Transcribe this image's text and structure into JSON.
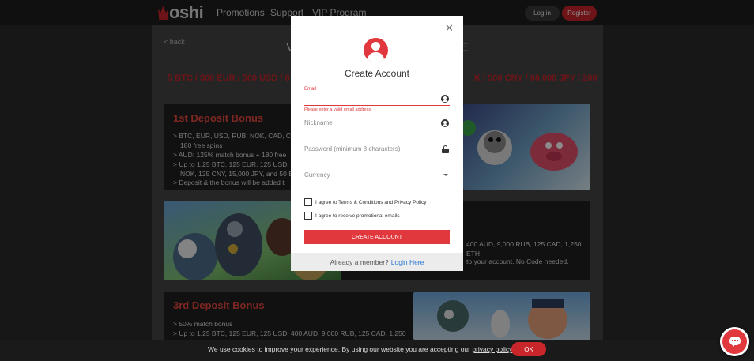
{
  "header": {
    "logo_text": "oshi",
    "nav": [
      "Promotions",
      "Support",
      "VIP Program"
    ],
    "login_label": "Log in",
    "register_label": "Register"
  },
  "page": {
    "back_label": "< back",
    "title_visible_start": "V",
    "title_visible_end": "E",
    "summary_left": "5 BTC / 500 EUR / 500 USD / 8",
    "summary_right": "K / 500 CNY / 60.000 JPY / 200"
  },
  "cards": [
    {
      "title": "1st Deposit Bonus",
      "lines": [
        "> BTC, EUR, USD, RUB, NOK, CAD, CNY",
        "180 free spins",
        "> AUD: 125% match bonus + 180 free",
        "> Up to 1.25 BTC, 125 EUR, 125 USD, 4",
        "NOK, 125 CNY, 15,000 JPY, and 50 ET",
        "> Deposit & the bonus will be added t"
      ]
    },
    {
      "lines": [
        "400 AUD, 9,000 RUB, 125 CAD, 1,250",
        "ETH",
        "to your account. No Code needed."
      ]
    },
    {
      "title": "3rd Deposit Bonus",
      "lines": [
        "> 50% match bonus",
        "> Up to 1.25 BTC, 125 EUR, 125 USD, 400 AUD, 9,000 RUB, 125 CAD, 1,250"
      ]
    }
  ],
  "modal": {
    "title": "Create Account",
    "email_label": "Email",
    "email_error": "Please enter a valid email address",
    "nickname_placeholder": "Nickname",
    "password_placeholder": "Password (minimum 8 characters)",
    "currency_placeholder": "Currency",
    "agree_prefix": "I agree to ",
    "terms_link": "Terms & Conditions",
    "agree_and": " and ",
    "privacy_link": "Privacy Policy",
    "promo_label": "I agree to receive promotional emails",
    "submit_label": "CREATE ACCOUNT",
    "footer_text": "Already a member?",
    "footer_link": "Login Here",
    "accent_color": "#e0383d"
  },
  "cookie": {
    "text": "We use cookies to improve your experience. By using our website you are accepting our ",
    "link": "privacy policy",
    "ok_label": "OK"
  }
}
